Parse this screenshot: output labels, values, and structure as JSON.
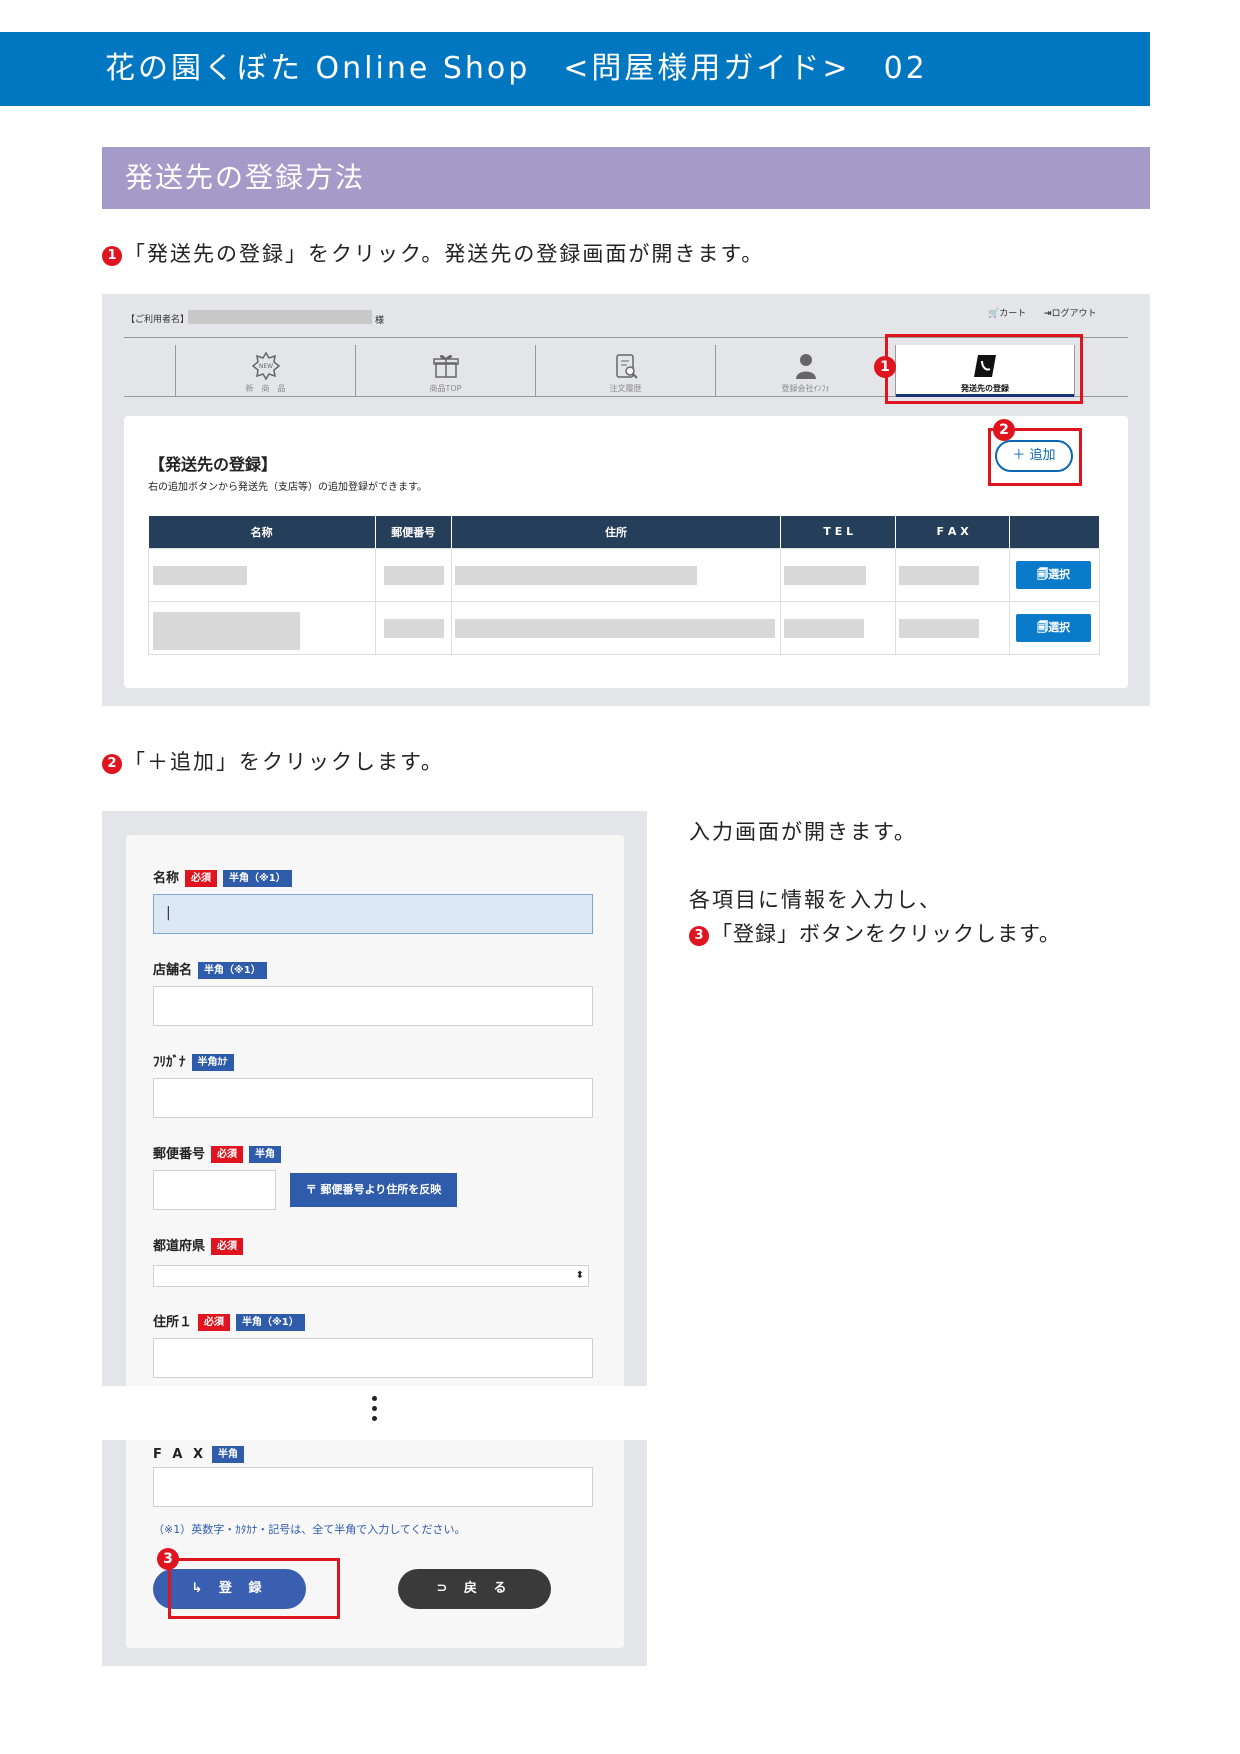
{
  "header": {
    "title": "花の園くぼた Online Shop　<問屋様用ガイド>　02"
  },
  "section": {
    "title": "発送先の登録方法"
  },
  "steps": {
    "step1": {
      "num": "1",
      "text": "「発送先の登録」をクリック。発送先の登録画面が開きます。"
    },
    "step2": {
      "num": "2",
      "text": "「＋追加」をクリックします。"
    }
  },
  "shot1": {
    "user_label": "【ご利用者名】",
    "user_suffix": "様",
    "cart": "カート",
    "logout": "ログアウト",
    "nav": [
      {
        "label": "新　商　品",
        "icon": "new-badge-icon"
      },
      {
        "label": "商品TOP",
        "icon": "gift-box-icon"
      },
      {
        "label": "注文履歴",
        "icon": "order-history-icon"
      },
      {
        "label": "登録会社ｲﾝﾌｫ",
        "icon": "person-icon"
      },
      {
        "label": "発送先の登録",
        "icon": "address-book-icon"
      }
    ],
    "badge1": "1",
    "badge2": "2",
    "card_title": "【発送先の登録】",
    "card_sub": "右の追加ボタンから発送先（支店等）の追加登録ができます。",
    "add_button": "＋ 追加",
    "columns": [
      "名称",
      "郵便番号",
      "住所",
      "T E L",
      "F A X",
      ""
    ],
    "select_button": "選択"
  },
  "form": {
    "name_label": "名称",
    "required": "必須",
    "halfwidth_note": "半角（※1）",
    "store_label": "店舗名",
    "kana_label": "ﾌﾘｶﾞﾅ",
    "kana_tag": "半角ｶﾅ",
    "zip_label": "郵便番号",
    "halfwidth": "半角",
    "zip_button": "〒 郵便番号より住所を反映",
    "pref_label": "都道府県",
    "addr1_label": "住所１",
    "fax_label": "F A X",
    "note": "（※1）英数字・ｶﾀｶﾅ・記号は、全て半角で入力してください。",
    "badge3": "3",
    "register_button": "↳ 登 録",
    "back_button": "⊃ 戻 る"
  },
  "side": {
    "line1": "入力画面が開きます。",
    "line2": "各項目に情報を入力し、",
    "line3_num": "3",
    "line3": "「登録」ボタンをクリックします。"
  },
  "colors": {
    "header": "#0077c0",
    "section": "#a59bc9",
    "accent_red": "#e0141e",
    "table_head": "#253e5a"
  }
}
